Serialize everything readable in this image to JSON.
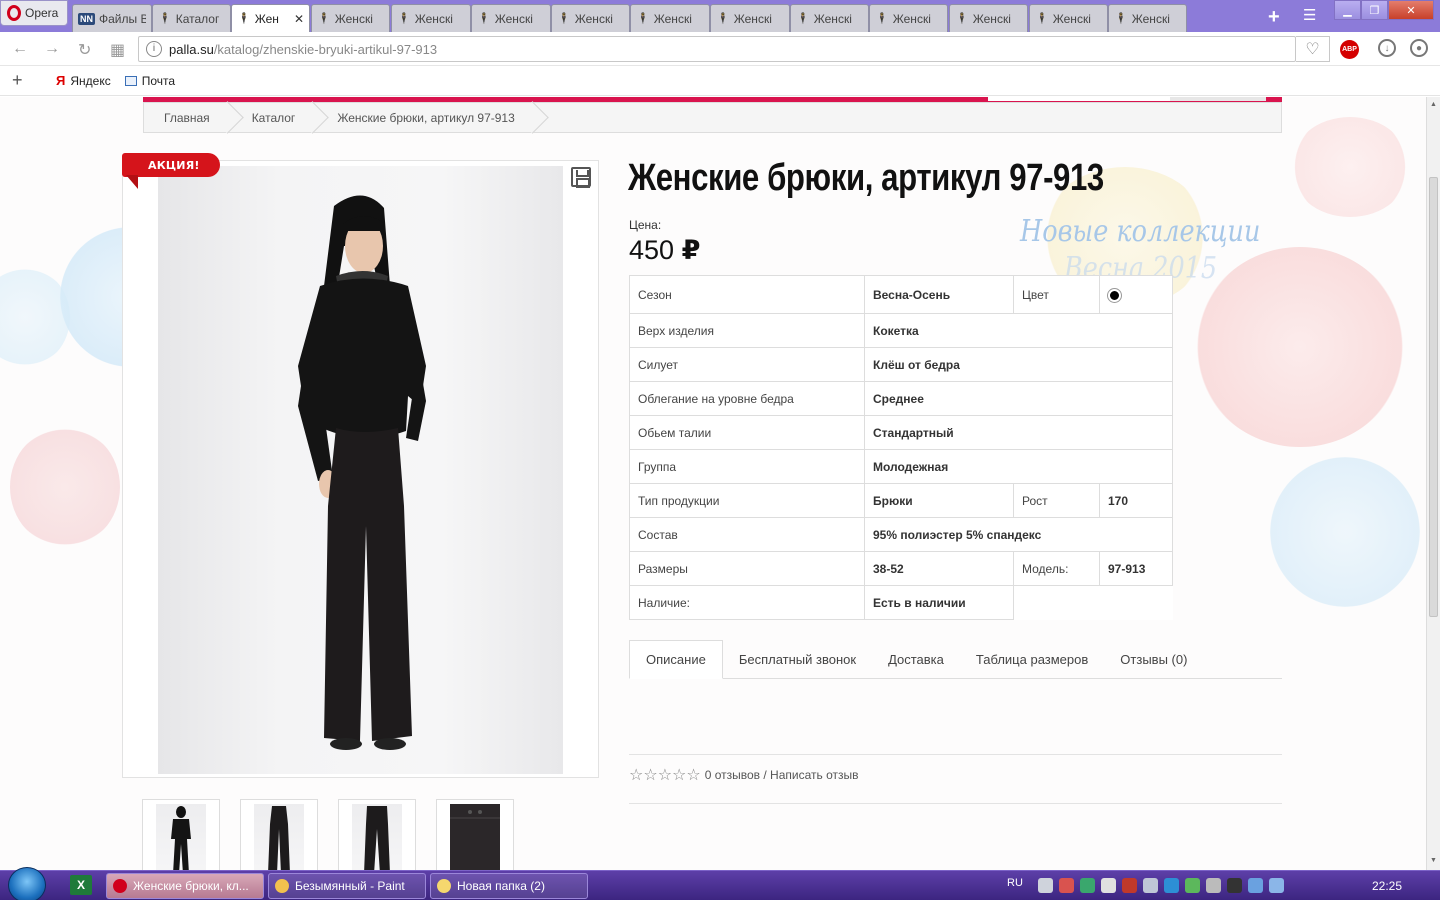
{
  "browser": {
    "menu_label": "Opera",
    "tabs": [
      {
        "label": "Файлы В",
        "favicon": "NN",
        "active": false
      },
      {
        "label": "Каталог",
        "favicon": "palla",
        "active": false
      },
      {
        "label": "Жен",
        "favicon": "palla",
        "active": true
      },
      {
        "label": "Женскі",
        "favicon": "palla",
        "active": false
      },
      {
        "label": "Женскі",
        "favicon": "palla",
        "active": false
      },
      {
        "label": "Женскі",
        "favicon": "palla",
        "active": false
      },
      {
        "label": "Женскі",
        "favicon": "palla",
        "active": false
      },
      {
        "label": "Женскі",
        "favicon": "palla",
        "active": false
      },
      {
        "label": "Женскі",
        "favicon": "palla",
        "active": false
      },
      {
        "label": "Женскі",
        "favicon": "palla",
        "active": false
      },
      {
        "label": "Женскі",
        "favicon": "palla",
        "active": false
      },
      {
        "label": "Женскі",
        "favicon": "palla",
        "active": false
      },
      {
        "label": "Женскі",
        "favicon": "palla",
        "active": false
      },
      {
        "label": "Женскі",
        "favicon": "palla",
        "active": false
      }
    ],
    "url_host": "palla.su",
    "url_path": "/katalog/zhenskie-bryuki-artikul-97-913",
    "adblock_label": "ABP",
    "bookmarks": [
      {
        "label": "Яндекс",
        "icon": "yandex-icon"
      },
      {
        "label": "Почта",
        "icon": "mail-icon"
      }
    ]
  },
  "breadcrumb": [
    "Главная",
    "Каталог",
    "Женские брюки, артикул 97-913"
  ],
  "promo_badge": "АКЦИЯ!",
  "product": {
    "title": "Женские брюки, артикул 97-913",
    "watermark_line1": "Новые коллекции",
    "watermark_line2": "Весна 2015",
    "price_label": "Цена:",
    "price_amount": "450",
    "currency": "₽",
    "color_value": "#000000",
    "attributes": {
      "season": {
        "label": "Сезон",
        "value": "Весна-Осень"
      },
      "color": {
        "label": "Цвет"
      },
      "top": {
        "label": "Верх изделия",
        "value": "Кокетка"
      },
      "silhouette": {
        "label": "Силует",
        "value": "Клёш от бедра"
      },
      "hip_fit": {
        "label": "Облегание на уровне бедра",
        "value": "Среднее"
      },
      "waist": {
        "label": "Обьем талии",
        "value": "Стандартный"
      },
      "group": {
        "label": "Группа",
        "value": "Молодежная"
      },
      "type": {
        "label": "Тип продукции",
        "value": "Брюки"
      },
      "height": {
        "label": "Рост",
        "value": "170"
      },
      "composition": {
        "label": "Состав",
        "value": "95% полиэстер 5% спандекс"
      },
      "sizes": {
        "label": "Размеры",
        "value": "38-52"
      },
      "model": {
        "label": "Модель:",
        "value": "97-913"
      },
      "availability": {
        "label": "Наличие:",
        "value": "Есть в наличии"
      }
    },
    "tabs": [
      "Описание",
      "Бесплатный звонок",
      "Доставка",
      "Таблица размеров",
      "Отзывы (0)"
    ],
    "active_tab": 0,
    "rating_stars": 0,
    "rating_max": 5,
    "rating_text": "0 отзывов / Написать отзыв"
  },
  "taskbar": {
    "tasks": [
      {
        "label": "Женские брюки, кл...",
        "active": true,
        "icon_color": "#d1001c"
      },
      {
        "label": "Безымянный - Paint",
        "active": false,
        "icon_color": "#f2c14e"
      },
      {
        "label": "Новая папка (2)",
        "active": false,
        "icon_color": "#f5d76e"
      }
    ],
    "language": "RU",
    "clock": "22:25"
  }
}
